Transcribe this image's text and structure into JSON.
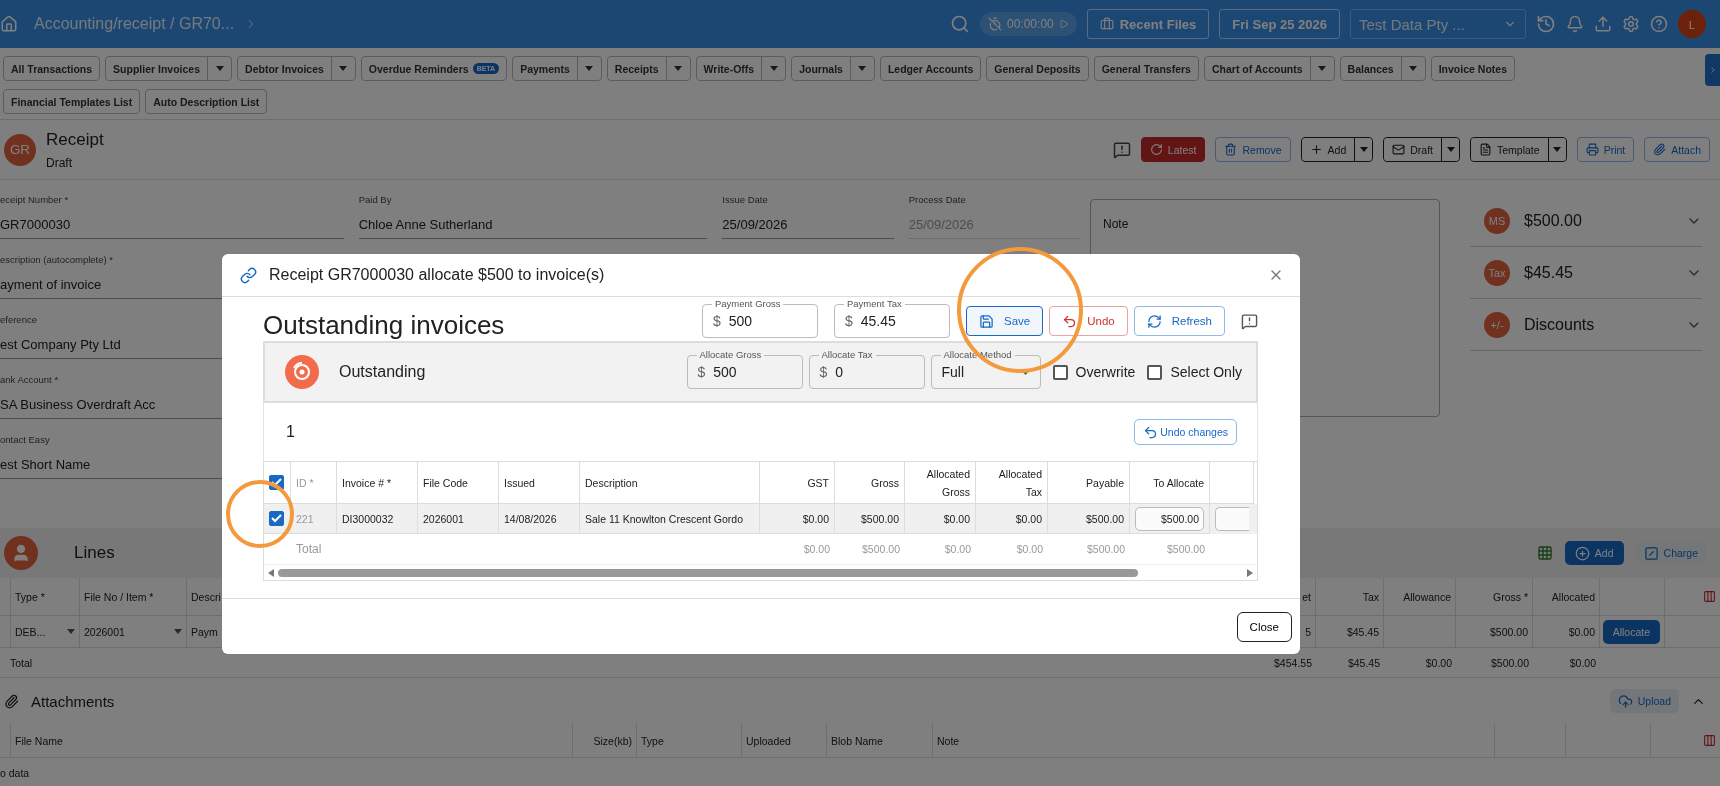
{
  "top_bar": {
    "breadcrumb": "Accounting/receipt / GR70...",
    "timer": "00:00:00",
    "recent_files": "Recent Files",
    "date": "Fri Sep 25 2026",
    "company": "Test Data Pty ...",
    "avatar": "L"
  },
  "nav_rows": [
    [
      {
        "label": "All Transactions",
        "dropdown": false
      },
      {
        "label": "Supplier Invoices",
        "dropdown": true
      },
      {
        "label": "Debtor Invoices",
        "dropdown": true
      },
      {
        "label": "Overdue Reminders",
        "badge": "BETA",
        "dropdown": false
      },
      {
        "label": "Payments",
        "dropdown": true
      },
      {
        "label": "Receipts",
        "dropdown": true
      },
      {
        "label": "Write-Offs",
        "dropdown": true
      },
      {
        "label": "Journals",
        "dropdown": true
      },
      {
        "label": "Ledger Accounts",
        "dropdown": false
      },
      {
        "label": "General Deposits",
        "dropdown": false
      },
      {
        "label": "General Transfers",
        "dropdown": false
      },
      {
        "label": "Chart of Accounts",
        "dropdown": true
      },
      {
        "label": "Balances",
        "dropdown": true
      },
      {
        "label": "Invoice Notes",
        "dropdown": false
      }
    ],
    [
      {
        "label": "Financial Templates List",
        "dropdown": false
      },
      {
        "label": "Auto Description List",
        "dropdown": false
      }
    ]
  ],
  "header": {
    "avatar": "GR",
    "title": "Receipt",
    "status": "Draft",
    "actions": [
      {
        "label": "Latest",
        "kind": "danger"
      },
      {
        "label": "Remove",
        "kind": "primary"
      },
      {
        "label": "Add",
        "kind": "split"
      },
      {
        "label": "Draft",
        "kind": "split"
      },
      {
        "label": "Template",
        "kind": "split"
      },
      {
        "label": "Print",
        "kind": "primary"
      },
      {
        "label": "Attach",
        "kind": "primary"
      }
    ]
  },
  "form": {
    "top_row": [
      {
        "label": "eceipt Number *",
        "value": "GR7000030",
        "disabled": false
      },
      {
        "label": "Paid By",
        "value": "Chloe Anne Sutherland",
        "disabled": false
      },
      {
        "label": "Issue Date",
        "value": "25/09/2026",
        "disabled": false
      },
      {
        "label": "Process Date",
        "value": "25/09/2026",
        "disabled": true
      }
    ],
    "left_fields": [
      {
        "label": "escription (autocomplete) *",
        "value": "ayment of invoice"
      },
      {
        "label": "eference",
        "value": "est Company Pty Ltd"
      },
      {
        "label": "ank Account *",
        "value": "SA Business Overdraft Acc"
      },
      {
        "label": "ontact Easy",
        "value": "est Short Name"
      }
    ],
    "note": {
      "label": "Note"
    }
  },
  "summary": [
    {
      "badge": "MS",
      "text": "$500.00"
    },
    {
      "badge": "Tax",
      "text": "$45.45"
    },
    {
      "badge": "+/-",
      "text": "Discounts"
    }
  ],
  "lines": {
    "title": "Lines",
    "add": "Add",
    "charge": "Charge",
    "columns": [
      "Type *",
      "File No / Item *",
      "Descri",
      "et",
      "Tax",
      "Allowance",
      "Gross *",
      "Allocated"
    ],
    "row": [
      "DEB...",
      "2026001",
      "Paym",
      "5",
      "$45.45",
      "$500.00",
      "$0.00"
    ],
    "row_action": "Allocate",
    "total": {
      "label": "Total",
      "cells": [
        "$454.55",
        "$45.45",
        "$0.00",
        "$500.00",
        "$0.00"
      ]
    }
  },
  "attachments": {
    "title": "Attachments",
    "upload": "Upload",
    "columns": [
      "File Name",
      "Size(kb)",
      "Type",
      "Uploaded",
      "Blob Name",
      "Note"
    ],
    "empty": "o data"
  },
  "modal": {
    "title": "Receipt GR7000030 allocate $500 to invoice(s)",
    "heading": "Outstanding invoices",
    "payment_fields": [
      {
        "label": "Payment Gross",
        "prefix": "$",
        "value": "500"
      },
      {
        "label": "Payment Tax",
        "prefix": "$",
        "value": "45.45"
      }
    ],
    "actions": [
      {
        "label": "Save",
        "kind": "save"
      },
      {
        "label": "Undo",
        "kind": "undo"
      },
      {
        "label": "Refresh",
        "kind": "refresh"
      }
    ],
    "panel": {
      "title": "Outstanding",
      "fields": [
        {
          "label": "Allocate Gross",
          "prefix": "$",
          "value": "500"
        },
        {
          "label": "Allocate Tax",
          "prefix": "$",
          "value": "0"
        }
      ],
      "method": {
        "label": "Allocate Method",
        "value": "Full"
      },
      "options": [
        {
          "label": "Overwrite",
          "checked": false
        },
        {
          "label": "Select Only",
          "checked": false
        }
      ]
    },
    "count": "1",
    "undo_changes": "Undo changes",
    "table": {
      "all_checked": true,
      "columns": [
        "ID *",
        "Invoice # *",
        "File Code",
        "Issued",
        "Description",
        "GST",
        "Gross",
        "Allocated Gross",
        "Allocated Tax",
        "Payable",
        "To Allocate"
      ],
      "rows": [
        {
          "selected": true,
          "cells": [
            "221",
            "DI3000032",
            "2026001",
            "14/08/2026",
            "Sale 11 Knowlton Crescent Gordo",
            "$0.00",
            "$500.00",
            "$0.00",
            "$0.00",
            "$500.00"
          ],
          "to_allocate": "$500.00"
        }
      ],
      "total": {
        "label": "Total",
        "cells": [
          "$0.00",
          "$500.00",
          "$0.00",
          "$0.00",
          "$500.00",
          "$500.00"
        ]
      }
    },
    "close": "Close"
  }
}
